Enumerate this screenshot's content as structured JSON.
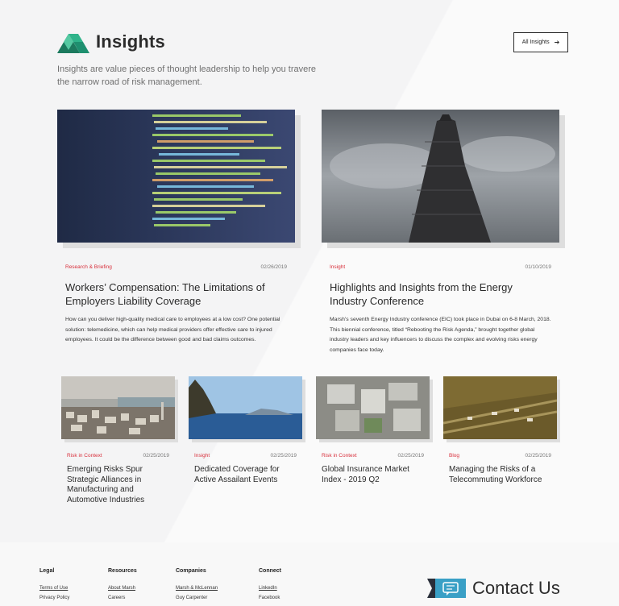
{
  "header": {
    "title": "Insights",
    "subtitle": "Insights are value pieces of thought leadership to help you travere the narrow road of risk management.",
    "all_insights_label": "All Insights"
  },
  "featured": [
    {
      "category": "Research & Briefing",
      "date": "02/26/2019",
      "title": "Workers’ Compensation: The Limitations of Employers Liability Coverage",
      "description": "How can you deliver high-quality medical care to employees at a low cost? One potential solution: telemedicine, which can help medical providers offer effective care to injured employees. It could be the difference between good and bad claims outcomes."
    },
    {
      "category": "Insight",
      "date": "01/10/2019",
      "title": "Highlights and Insights from the Energy Industry Conference",
      "description": "Marsh’s seventh Energy Industry conference (EIC) took place in Dubai on 6-8 March, 2018. This biennial conference, titled “Rebooting the Risk Agenda,” brought together global industry leaders and key influencers to discuss the complex and evolving risks energy companies face today."
    }
  ],
  "cards": [
    {
      "category": "Risk in Context",
      "date": "02/25/2019",
      "title": "Emerging Risks Spur Strategic Alliances in Manufacturing and Automotive Industries"
    },
    {
      "category": "Insight",
      "date": "02/25/2019",
      "title": "Dedicated Coverage for Active Assailant Events"
    },
    {
      "category": "Risk in Context",
      "date": "02/25/2019",
      "title": "Global Insurance Market Index - 2019 Q2"
    },
    {
      "category": "Blog",
      "date": "02/25/2019",
      "title": "Managing the Risks of a Telecommuting Workforce"
    }
  ],
  "footer": {
    "columns": [
      {
        "heading": "Legal",
        "links": [
          "Terms of Use",
          "Privacy Policy"
        ]
      },
      {
        "heading": "Resources",
        "links": [
          "About Marsh",
          "Careers"
        ]
      },
      {
        "heading": "Companies",
        "links": [
          "Marsh & McLennan",
          "Guy Carpenter"
        ]
      },
      {
        "heading": "Connect",
        "links": [
          "LinkedIn",
          "Facebook"
        ]
      }
    ],
    "contact_label": "Contact Us"
  },
  "colors": {
    "accent": "#d8303c",
    "logo_green": "#1e8f6f",
    "contact_blue": "#3aa0c6"
  }
}
